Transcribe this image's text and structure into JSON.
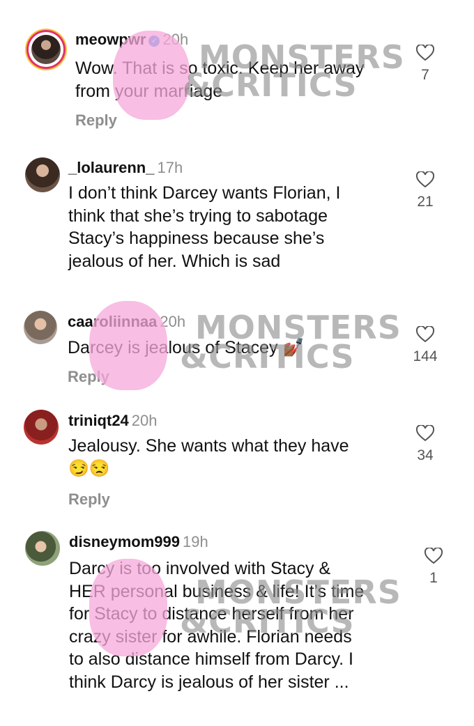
{
  "watermark": {
    "line1": "MONSTERS",
    "line2": "&CRITICS"
  },
  "comments": [
    {
      "username": "meowpwr",
      "verified": true,
      "time": "20h",
      "lines": [
        "Wow. That is so toxic.  Keep her away",
        "from your marriage"
      ],
      "reply": "Reply",
      "likes": "7"
    },
    {
      "username": "_lolaurenn_",
      "time": "17h",
      "lines": [
        "I don’t think Darcey wants Florian, I",
        "think that she’s trying to sabotage",
        "Stacy’s happiness because she’s",
        "jealous of her. Which is sad"
      ],
      "likes": "21"
    },
    {
      "username": "caaroliinnaa",
      "time": "20h",
      "lines": [
        "Darcey is jealous of Stacey 💅🏾"
      ],
      "reply": "Reply",
      "likes": "144"
    },
    {
      "username": "triniqt24",
      "time": "20h",
      "lines": [
        "Jealousy. She wants what they have"
      ],
      "emoji": "😏😒",
      "reply": "Reply",
      "likes": "34"
    },
    {
      "username": "disneymom999",
      "time": "19h",
      "lines": [
        "Darcy is too involved with Stacy &",
        "HER personal business & life! It’s time",
        "for Stacy to distance herself from her",
        "crazy sister for awhile. Florian needs",
        "to also distance himself from Darcy. I",
        "think Darcy is jealous of her sister ..."
      ],
      "likes": "1"
    }
  ]
}
